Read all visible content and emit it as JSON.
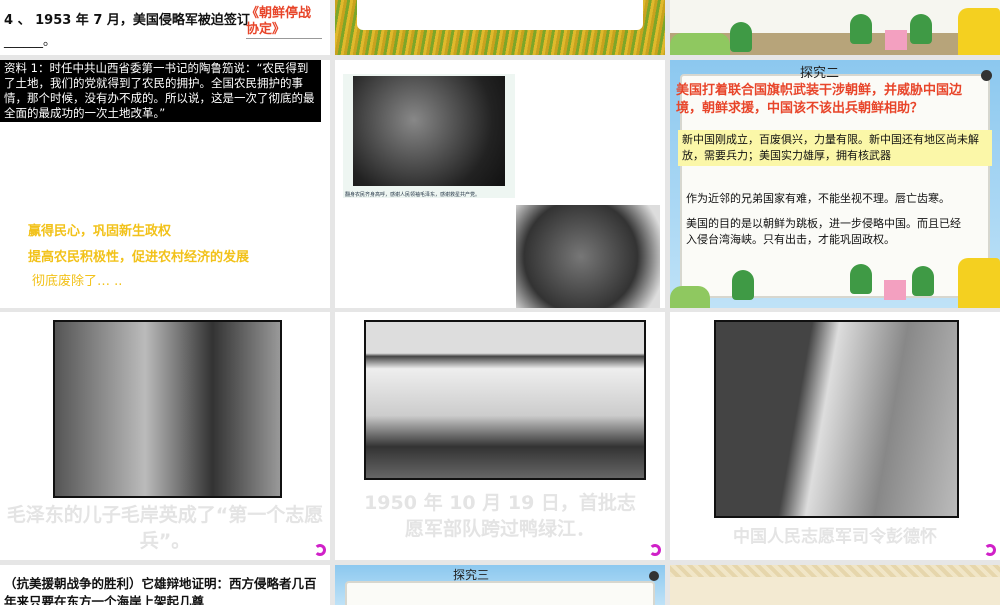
{
  "slides": {
    "s1": {
      "question": "4 、 1953 年 7 月，美国侵略军被迫签订",
      "answer": "《朝鲜停战协定》",
      "blank": "______。"
    },
    "s4": {
      "material": "资料 1：时任中共山西省委第一书记的陶鲁笳说：“农民得到了土地，我们的党就得到了农民的拥护。全国农民拥护的事情，那个时候，没有办不成的。所以说，这是一次了彻底的最全面的最成功的一次土地改革。”",
      "point1": "赢得民心，巩固新生政权",
      "point2": "提高农民积极性，促进农村经济的发展",
      "point3": "彻底废除了… .."
    },
    "s5": {
      "photo_caption": "翻身农民齐身高呼，感谢人民领袖毛泽东，感谢救星共产党。"
    },
    "s6": {
      "heading": "探究二",
      "question": "美国打着联合国旗帜武装干涉朝鲜，并威胁中国边境，朝鲜求援，中国该不该出兵朝鲜相助？",
      "reason1": "新中国刚成立，百废俱兴，力量有限。新中国还有地区尚未解放，需要兵力；美国实力雄厚，拥有核武器",
      "reason2": "作为近邻的兄弟国家有难，不能坐视不理。唇亡齿寒。",
      "reason3": "美国的目的是以朝鲜为跳板，进一步侵略中国。而且已经入侵台湾海峡。只有出击，才能巩固政权。"
    },
    "s7": {
      "caption": "毛泽东的儿子毛岸英成了“第一个志愿兵”。"
    },
    "s8": {
      "caption": "1950 年 10 月 19 日，首批志愿军部队跨过鸭绿江．"
    },
    "s9": {
      "caption": "中国人民志愿军司令彭德怀"
    },
    "s10": {
      "text": "（抗美援朝战争的胜利）它雄辩地证明：西方侵略者几百年来只要在东方一个海岸上架起几尊"
    },
    "s11": {
      "heading": "探究三"
    }
  },
  "colors": {
    "accent_red": "#e8452a",
    "yellow": "#f2c21a",
    "arrow": "#d020c8"
  }
}
